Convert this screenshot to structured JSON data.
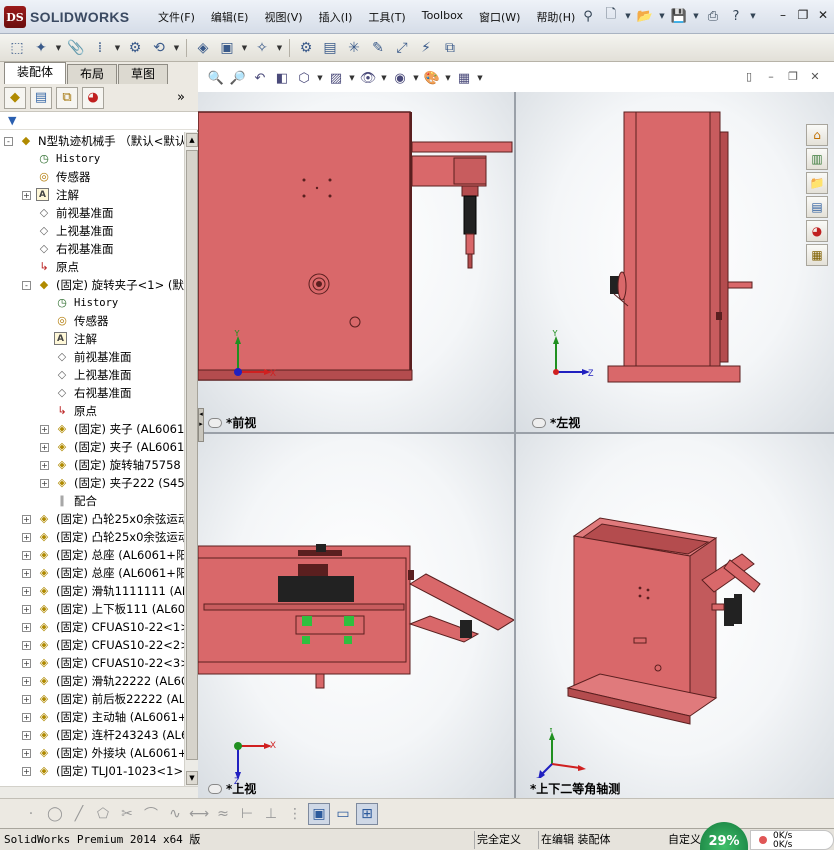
{
  "app": {
    "logo_text": "SOLIDWORKS",
    "logo_mark": "DS"
  },
  "menu": [
    "文件(F)",
    "编辑(E)",
    "视图(V)",
    "插入(I)",
    "工具(T)",
    "Toolbox",
    "窗口(W)",
    "帮助(H)"
  ],
  "feature_manager": {
    "tabs": [
      "装配体",
      "布局",
      "草图"
    ],
    "expand_glyph": "»",
    "filter_glyph": "▼",
    "tree": [
      {
        "label": "N型轨迹机械手 （默认<默认_",
        "icon": "assembly-icon",
        "indent": 0,
        "expander": "-",
        "mono": false
      },
      {
        "label": "History",
        "icon": "history-icon",
        "indent": 1,
        "expander": "",
        "mono": true
      },
      {
        "label": "传感器",
        "icon": "sensor-icon",
        "indent": 1,
        "expander": "",
        "mono": false
      },
      {
        "label": "注解",
        "icon": "annotation-icon",
        "indent": 1,
        "expander": "+",
        "mono": false
      },
      {
        "label": "前视基准面",
        "icon": "plane-icon",
        "indent": 1,
        "expander": "",
        "mono": false
      },
      {
        "label": "上视基准面",
        "icon": "plane-icon",
        "indent": 1,
        "expander": "",
        "mono": false
      },
      {
        "label": "右视基准面",
        "icon": "plane-icon",
        "indent": 1,
        "expander": "",
        "mono": false
      },
      {
        "label": "原点",
        "icon": "origin-icon",
        "indent": 1,
        "expander": "",
        "mono": false
      },
      {
        "label": "(固定) 旋转夹子<1> (默认",
        "icon": "subassembly-icon",
        "indent": 1,
        "expander": "-",
        "mono": false
      },
      {
        "label": "History",
        "icon": "history-icon",
        "indent": 2,
        "expander": "",
        "mono": true
      },
      {
        "label": "传感器",
        "icon": "sensor-icon",
        "indent": 2,
        "expander": "",
        "mono": false
      },
      {
        "label": "注解",
        "icon": "annotation-icon",
        "indent": 2,
        "expander": "",
        "mono": false
      },
      {
        "label": "前视基准面",
        "icon": "plane-icon",
        "indent": 2,
        "expander": "",
        "mono": false
      },
      {
        "label": "上视基准面",
        "icon": "plane-icon",
        "indent": 2,
        "expander": "",
        "mono": false
      },
      {
        "label": "右视基准面",
        "icon": "plane-icon",
        "indent": 2,
        "expander": "",
        "mono": false
      },
      {
        "label": "原点",
        "icon": "origin-icon",
        "indent": 2,
        "expander": "",
        "mono": false
      },
      {
        "label": "(固定) 夹子 (AL6061+阳",
        "icon": "part-icon",
        "indent": 2,
        "expander": "+",
        "mono": false
      },
      {
        "label": "(固定) 夹子 (AL6061+阳",
        "icon": "part-icon",
        "indent": 2,
        "expander": "+",
        "mono": false
      },
      {
        "label": "(固定) 旋转轴75758 (A",
        "icon": "part-icon",
        "indent": 2,
        "expander": "+",
        "mono": false
      },
      {
        "label": "(固定) 夹子222 (S45C)",
        "icon": "part-icon",
        "indent": 2,
        "expander": "+",
        "mono": false
      },
      {
        "label": "配合",
        "icon": "mates-icon",
        "indent": 2,
        "expander": "",
        "mono": false
      },
      {
        "label": "(固定) 凸轮25x0余弦运动",
        "icon": "part-icon",
        "indent": 1,
        "expander": "+",
        "mono": false
      },
      {
        "label": "(固定) 凸轮25x0余弦运动",
        "icon": "part-icon",
        "indent": 1,
        "expander": "+",
        "mono": false
      },
      {
        "label": "(固定) 总座 (AL6061+阳极",
        "icon": "part-icon",
        "indent": 1,
        "expander": "+",
        "mono": false
      },
      {
        "label": "(固定) 总座 (AL6061+阳极",
        "icon": "part-icon",
        "indent": 1,
        "expander": "+",
        "mono": false
      },
      {
        "label": "(固定) 滑轨1111111 (AL60",
        "icon": "part-icon",
        "indent": 1,
        "expander": "+",
        "mono": false
      },
      {
        "label": "(固定) 上下板111 (AL6061",
        "icon": "part-icon",
        "indent": 1,
        "expander": "+",
        "mono": false
      },
      {
        "label": "(固定) CFUAS10-22<1> (默",
        "icon": "part-icon",
        "indent": 1,
        "expander": "+",
        "mono": false
      },
      {
        "label": "(固定) CFUAS10-22<2> (默",
        "icon": "part-icon",
        "indent": 1,
        "expander": "+",
        "mono": false
      },
      {
        "label": "(固定) CFUAS10-22<3> (默",
        "icon": "part-icon",
        "indent": 1,
        "expander": "+",
        "mono": false
      },
      {
        "label": "(固定) 滑轨22222 (AL6061",
        "icon": "part-icon",
        "indent": 1,
        "expander": "+",
        "mono": false
      },
      {
        "label": "(固定) 前后板22222 (AL60",
        "icon": "part-icon",
        "indent": 1,
        "expander": "+",
        "mono": false
      },
      {
        "label": "(固定) 主动轴 (AL6061+阳",
        "icon": "part-icon",
        "indent": 1,
        "expander": "+",
        "mono": false
      },
      {
        "label": "(固定) 连杆243243 (AL606",
        "icon": "part-icon",
        "indent": 1,
        "expander": "+",
        "mono": false
      },
      {
        "label": "(固定) 外接块 (AL6061+阳",
        "icon": "part-icon",
        "indent": 1,
        "expander": "+",
        "mono": false
      },
      {
        "label": "(固定) TLJ01-1023<1> (默",
        "icon": "part-icon",
        "indent": 1,
        "expander": "+",
        "mono": false
      }
    ]
  },
  "viewports": {
    "front": "*前视",
    "left": "*左视",
    "top": "*上视",
    "iso": "*上下二等角轴测"
  },
  "axes": {
    "x": "X",
    "y": "Y",
    "z": "Z"
  },
  "status": {
    "app_version": "SolidWorks Premium 2014 x64 版",
    "definition": "完全定义",
    "mode": "在编辑 装配体",
    "custom": "自定义",
    "net_percent": "29%",
    "net_up": "0K/s",
    "net_down": "0K/s"
  },
  "colors": {
    "part_body": "#d9686a",
    "part_edge": "#5a1f1f",
    "part_dark": "#b44c4e",
    "accent_green": "#2fbf3f",
    "axis_x": "#d02020",
    "axis_y": "#209020",
    "axis_z": "#2020c0"
  }
}
